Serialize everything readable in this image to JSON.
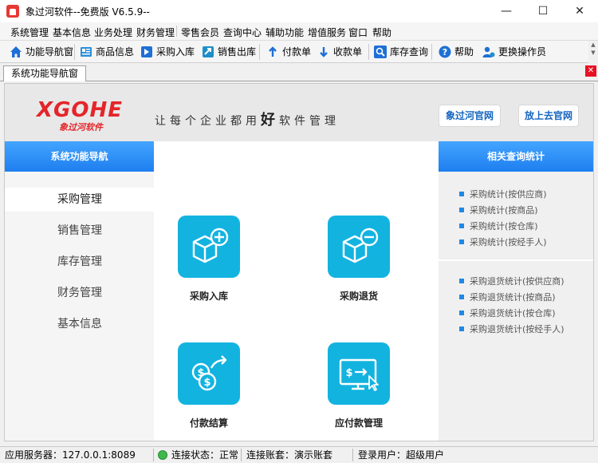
{
  "window": {
    "title": "象过河软件--免费版 V6.5.9--",
    "minimize": "—",
    "maximize": "☐",
    "close": "✕"
  },
  "menu": [
    "系统管理",
    "基本信息",
    "业务处理",
    "财务管理",
    "零售会员",
    "查询中心",
    "辅助功能",
    "增值服务",
    "窗口",
    "帮助"
  ],
  "toolbar": [
    {
      "label": "功能导航窗",
      "icon": "home-icon"
    },
    {
      "label": "商品信息",
      "icon": "products-icon"
    },
    {
      "label": "采购入库",
      "icon": "purchase-in-icon"
    },
    {
      "label": "销售出库",
      "icon": "sales-out-icon"
    },
    {
      "label": "付款单",
      "icon": "payment-icon"
    },
    {
      "label": "收款单",
      "icon": "receipt-icon"
    },
    {
      "label": "库存查询",
      "icon": "search-icon"
    },
    {
      "label": "帮助",
      "icon": "help-icon"
    },
    {
      "label": "更换操作员",
      "icon": "user-switch-icon"
    }
  ],
  "tab": {
    "label": "系统功能导航窗",
    "close": "✕"
  },
  "header": {
    "logo": "XGOHE",
    "logo_sub": "象过河软件",
    "slogan_pre": "让每个企业都用",
    "slogan_big": "好",
    "slogan_post": "软件管理",
    "btn_official": "象过河官网",
    "btn_go": "放上去官网"
  },
  "leftnav": {
    "title": "系统功能导航",
    "items": [
      "采购管理",
      "销售管理",
      "库存管理",
      "财务管理",
      "基本信息"
    ],
    "active_index": 0
  },
  "functions": [
    {
      "label": "采购入库",
      "icon": "box-add-icon"
    },
    {
      "label": "采购退货",
      "icon": "box-remove-icon"
    },
    {
      "label": "付款结算",
      "icon": "coins-transfer-icon"
    },
    {
      "label": "应付款管理",
      "icon": "monitor-payment-icon"
    }
  ],
  "rightpanel": {
    "title": "相关查询统计",
    "group1": [
      "采购统计(按供应商)",
      "采购统计(按商品)",
      "采购统计(按仓库)",
      "采购统计(按经手人)"
    ],
    "group2": [
      "采购退货统计(按供应商)",
      "采购退货统计(按商品)",
      "采购退货统计(按仓库)",
      "采购退货统计(按经手人)"
    ]
  },
  "status": {
    "server": "应用服务器：127.0.0.1:8089",
    "conn": "连接状态：正常",
    "account": "连接账套：演示账套",
    "user": "登录用户：超级用户"
  },
  "colors": {
    "accent": "#1e7ff0",
    "tile": "#13b3e0",
    "logo": "#e4252a",
    "ok": "#3cb94a"
  }
}
